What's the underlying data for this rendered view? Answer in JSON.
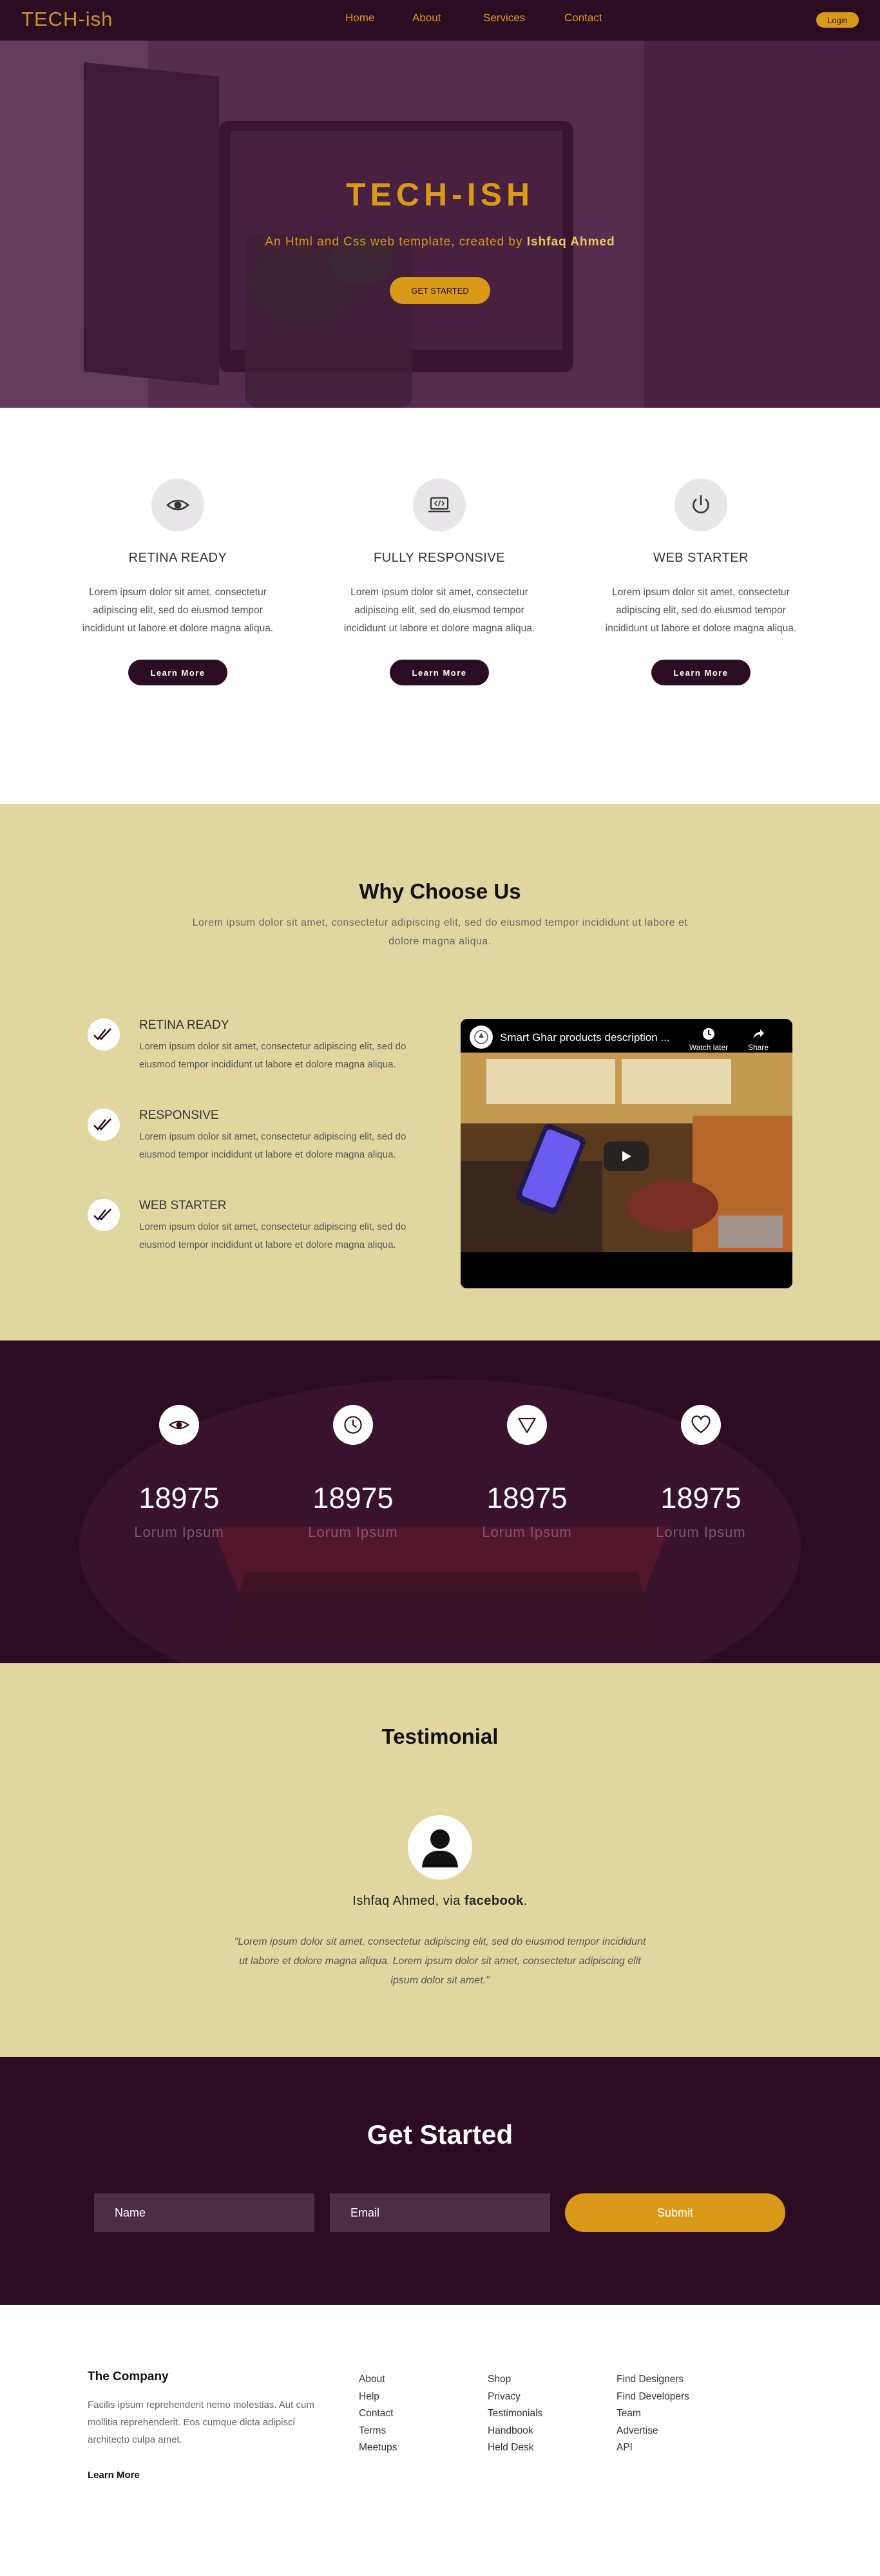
{
  "nav": {
    "brand": "TECH-ish",
    "links": [
      "Home",
      "About",
      "Services",
      "Contact"
    ],
    "login": "Login"
  },
  "hero": {
    "title": "TECH-ISH",
    "subtitle_prefix": "An Html and Css web template, created by ",
    "subtitle_author": "Ishfaq Ahmed",
    "button": "GET STARTED"
  },
  "features": [
    {
      "icon": "eye-icon",
      "title": "RETINA READY",
      "text": "Lorem ipsum dolor sit amet, consectetur adipiscing elit, sed do eiusmod tempor incididunt ut labore et dolore magna aliqua.",
      "button": "Learn More"
    },
    {
      "icon": "code-laptop-icon",
      "title": "FULLY RESPONSIVE",
      "text": "Lorem ipsum dolor sit amet, consectetur adipiscing elit, sed do eiusmod tempor incididunt ut labore et dolore magna aliqua.",
      "button": "Learn More"
    },
    {
      "icon": "power-icon",
      "title": "WEB STARTER",
      "text": "Lorem ipsum dolor sit amet, consectetur adipiscing elit, sed do eiusmod tempor incididunt ut labore et dolore magna aliqua.",
      "button": "Learn More"
    }
  ],
  "why": {
    "title": "Why Choose Us",
    "subtitle": "Lorem ipsum dolor sit amet, consectetur adipiscing elit, sed do eiusmod tempor incididunt ut labore et dolore magna aliqua.",
    "items": [
      {
        "title": "RETINA READY",
        "text": "Lorem ipsum dolor sit amet, consectetur adipiscing elit, sed do eiusmod tempor incididunt ut labore et dolore magna aliqua."
      },
      {
        "title": "RESPONSIVE",
        "text": "Lorem ipsum dolor sit amet, consectetur adipiscing elit, sed do eiusmod tempor incididunt ut labore et dolore magna aliqua."
      },
      {
        "title": "WEB STARTER",
        "text": "Lorem ipsum dolor sit amet, consectetur adipiscing elit, sed do eiusmod tempor incididunt ut labore et dolore magna aliqua."
      }
    ],
    "video": {
      "title": "Smart Ghar products description ...",
      "watch_later": "Watch later",
      "share": "Share"
    }
  },
  "stats": [
    {
      "icon": "eye-icon",
      "number": "18975",
      "label": "Lorum Ipsum"
    },
    {
      "icon": "clock-icon",
      "number": "18975",
      "label": "Lorum Ipsum"
    },
    {
      "icon": "triangle-down-icon",
      "number": "18975",
      "label": "Lorum Ipsum"
    },
    {
      "icon": "heart-icon",
      "number": "18975",
      "label": "Lorum Ipsum"
    }
  ],
  "testimonial": {
    "title": "Testimonial",
    "name_prefix": "Ishfaq Ahmed, via ",
    "name_source": "facebook",
    "name_suffix": ".",
    "quote": "\"Lorem ipsum dolor sit amet, consectetur adipiscing elit, sed do eiusmod tempor incididunt ut labore et dolore magna aliqua. Lorem ipsum dolor sit amet, consectetur adipiscing elit ipsum dolor sit amet.\""
  },
  "get_started": {
    "title": "Get Started",
    "name_placeholder": "Name",
    "email_placeholder": "Email",
    "submit": "Submit"
  },
  "footer": {
    "company_title": "The Company",
    "company_text": "Facilis ipsum reprehenderit nemo molestias. Aut cum mollitia reprehenderit. Eos cumque dicta adipisci architecto culpa amet.",
    "company_more": "Learn More",
    "col1": [
      "About",
      "Help",
      "Contact",
      "Terms",
      "Meetups"
    ],
    "col2": [
      "Shop",
      "Privacy",
      "Testimonials",
      "Handbook",
      "Held Desk"
    ],
    "col3": [
      "Find Designers",
      "Find Developers",
      "Team",
      "Advertise",
      "API"
    ]
  },
  "colors": {
    "dark": "#2c0c22",
    "accent": "#d89a18",
    "sand": "#dfd79f"
  }
}
